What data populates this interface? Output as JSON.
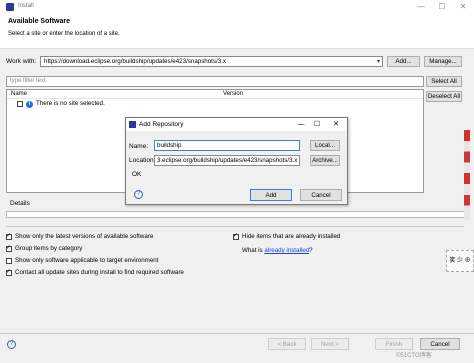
{
  "window": {
    "title": "Install",
    "minimize": "—",
    "maximize": "☐",
    "close": "✕"
  },
  "header": {
    "title": "Available Software",
    "subtitle": "Select a site or enter the location of a site."
  },
  "work_with": {
    "label": "Work with:",
    "value": "https://download.eclipse.org/buildship/updates/e423/snapshots/3.x",
    "add_button": "Add...",
    "manage_button": "Manage..."
  },
  "filter": {
    "placeholder": "type filter text"
  },
  "buttons": {
    "select_all": "Select All",
    "deselect_all": "Deselect All"
  },
  "tree": {
    "columns": [
      "Name",
      "Version"
    ],
    "rows": [
      {
        "label": "There is no site selected."
      }
    ]
  },
  "details": {
    "label": "Details"
  },
  "options": {
    "show_latest": "Show only the latest versions of available software",
    "group_by_category": "Group items by category",
    "show_applicable": "Show only software applicable to target environment",
    "contact_sites": "Contact all update sites during install to find required software",
    "hide_installed": "Hide items that are already installed",
    "what_is": "What is",
    "already_installed_link": "already installed",
    "what_is_suffix": "?"
  },
  "footer": {
    "back": "< Back",
    "next": "Next >",
    "finish": "Finish",
    "cancel": "Cancel",
    "help": "?"
  },
  "dialog": {
    "title": "Add Repository",
    "name_label": "Name:",
    "name_value": "buildship",
    "local_button": "Local...",
    "location_label": "Location:",
    "location_value": "3.eclipse.org/buildship/updates/e423/snapshots/3.x",
    "archive_button": "Archive...",
    "status": "OK",
    "add_button": "Add",
    "cancel_button": "Cancel",
    "help": "?"
  },
  "side_label": "笑 少 ⊕",
  "watermark": "©51CTO博客"
}
